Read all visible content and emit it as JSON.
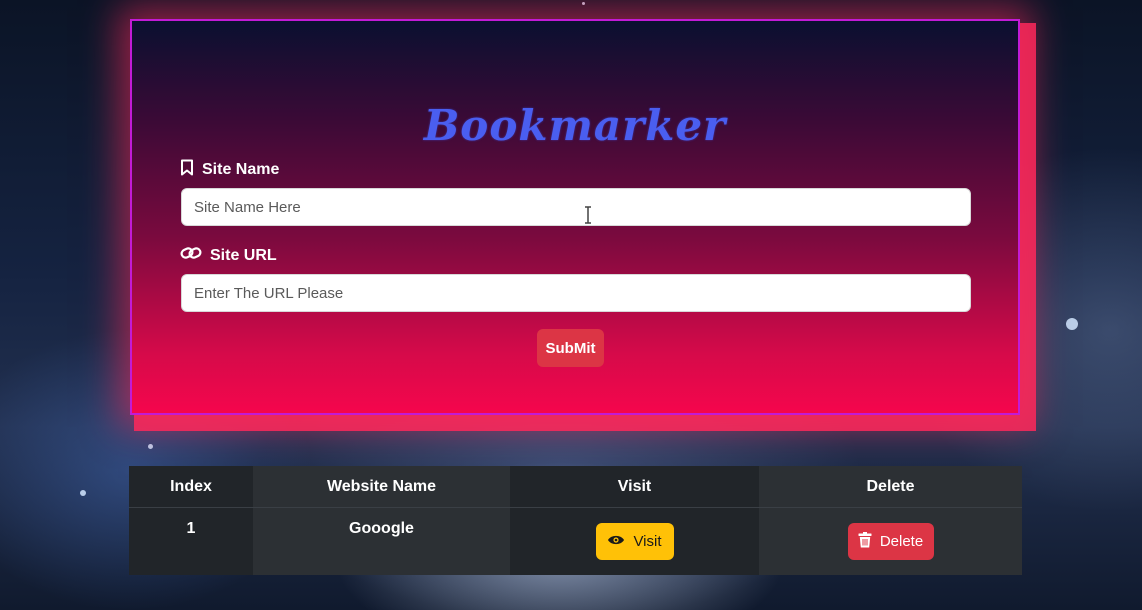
{
  "app": {
    "title": "Bookmarker"
  },
  "form": {
    "site_name_label": "Site Name",
    "site_name_placeholder": "Site Name Here",
    "site_name_value": "",
    "site_url_label": "Site URL",
    "site_url_placeholder": "Enter The URL Please",
    "site_url_value": "",
    "submit_label": "SubMit",
    "icons": {
      "site_name": "bookmark-icon",
      "site_url": "link-icon"
    }
  },
  "table": {
    "headers": [
      "Index",
      "Website Name",
      "Visit",
      "Delete"
    ],
    "rows": [
      {
        "index": "1",
        "website_name": "Gooogle",
        "visit_label": "Visit",
        "delete_label": "Delete"
      }
    ],
    "icons": {
      "visit": "eye-icon",
      "delete": "trash-icon"
    }
  },
  "colors": {
    "title": "#4a5ef0",
    "submit": "#dc3545",
    "visit": "#ffc107",
    "delete": "#dc3545",
    "card_border": "#c21bd6"
  }
}
